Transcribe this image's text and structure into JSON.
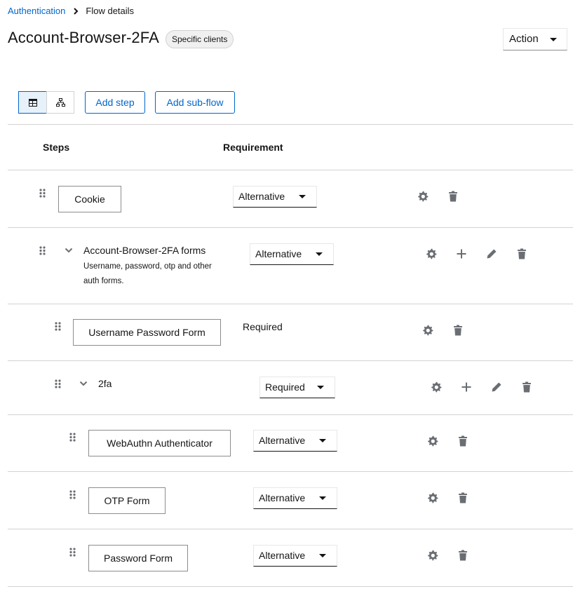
{
  "breadcrumb": {
    "parent": "Authentication",
    "current": "Flow details"
  },
  "header": {
    "title": "Account-Browser-2FA",
    "badge": "Specific clients",
    "action_label": "Action"
  },
  "toolbar": {
    "add_step": "Add step",
    "add_subflow": "Add sub-flow",
    "view_table_icon": "table-icon",
    "view_diagram_icon": "diagram-icon"
  },
  "table": {
    "headers": {
      "steps": "Steps",
      "requirement": "Requirement"
    },
    "rows": [
      {
        "name": "Cookie",
        "requirement": "Alternative",
        "kind": "execution"
      },
      {
        "name": "Account-Browser-2FA forms",
        "description": "Username, password, otp and other auth forms.",
        "requirement": "Alternative",
        "kind": "subflow"
      },
      {
        "name": "Username Password Form",
        "requirement": "Required",
        "kind": "execution"
      },
      {
        "name": "2fa",
        "requirement": "Required",
        "kind": "subflow"
      },
      {
        "name": "WebAuthn Authenticator",
        "requirement": "Alternative",
        "kind": "execution"
      },
      {
        "name": "OTP Form",
        "requirement": "Alternative",
        "kind": "execution"
      },
      {
        "name": "Password Form",
        "requirement": "Alternative",
        "kind": "execution"
      }
    ]
  },
  "icons": {
    "drag": "drag-handle-icon",
    "settings": "gear-icon",
    "add": "plus-icon",
    "edit": "pencil-icon",
    "delete": "trash-icon",
    "expand": "chevron-down-icon"
  },
  "colors": {
    "link": "#0066cc",
    "text": "#151515",
    "icon": "#6a6e73",
    "border": "#d2d2d2"
  }
}
